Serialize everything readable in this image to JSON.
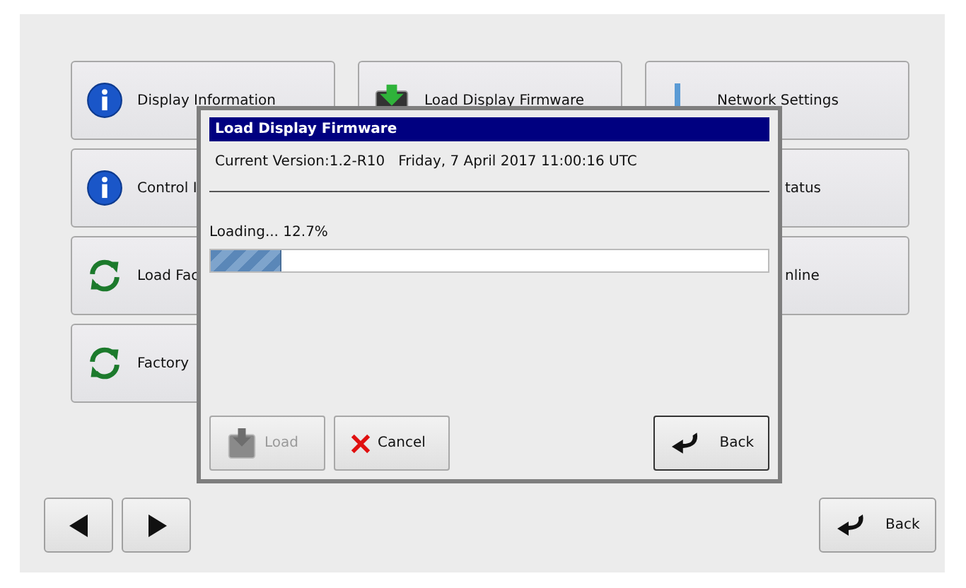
{
  "columns": [
    [
      {
        "label": "Display Information",
        "kind": "info"
      },
      {
        "label": "Control I",
        "kind": "info"
      },
      {
        "label": "Load Fac",
        "kind": "refresh"
      },
      {
        "label": "Factory",
        "kind": "refresh"
      }
    ],
    [
      {
        "label": "Load Display Firmware",
        "kind": "firmware"
      }
    ],
    [
      {
        "label": "Network Settings",
        "kind": "network"
      },
      {
        "label": "tatus",
        "kind": "covered"
      },
      {
        "label": "nline",
        "kind": "covered"
      }
    ]
  ],
  "nav": [
    {
      "kind": "prev"
    },
    {
      "kind": "next"
    }
  ],
  "back_button": {
    "label": "Back"
  },
  "dialog": {
    "title": "Load Display Firmware",
    "version": "Current Version:1.2-R10   Friday, 7 April 2017 11:00:16 UTC",
    "loading": "Loading... 12.7%",
    "progress": {
      "level": 0.127
    },
    "buttons": [
      {
        "label": "Load",
        "kind": "load",
        "disabled": true,
        "default": false
      },
      {
        "label": "Cancel",
        "kind": "cancel",
        "disabled": false,
        "default": false
      },
      {
        "label": "Back",
        "kind": "back",
        "disabled": false,
        "default": true
      }
    ]
  }
}
